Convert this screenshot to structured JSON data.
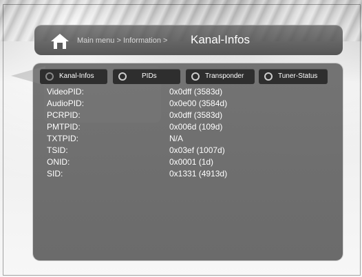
{
  "header": {
    "breadcrumb": "Main menu > Information >",
    "title": "Kanal-Infos"
  },
  "tabs": [
    {
      "label": "Kanal-Infos",
      "selected": true
    },
    {
      "label": "PIDs",
      "selected": false
    },
    {
      "label": "Transponder",
      "selected": false
    },
    {
      "label": "Tuner-Status",
      "selected": false
    }
  ],
  "info": [
    {
      "label": "VideoPID:",
      "value": "0x0dff (3583d)"
    },
    {
      "label": "AudioPID:",
      "value": "0x0e00 (3584d)"
    },
    {
      "label": "PCRPID:",
      "value": "0x0dff (3583d)"
    },
    {
      "label": "PMTPID:",
      "value": "0x006d (109d)"
    },
    {
      "label": "TXTPID:",
      "value": "N/A"
    },
    {
      "label": "TSID:",
      "value": "0x03ef (1007d)"
    },
    {
      "label": "ONID:",
      "value": "0x0001 (1d)"
    },
    {
      "label": "SID:",
      "value": "0x1331 (4913d)"
    }
  ],
  "colors": {
    "panel": "#646464",
    "tab_bg": "#2e2e2e",
    "text": "#ffffff"
  },
  "icons": {
    "home": "home-icon",
    "radio": "radio-button-icon"
  }
}
